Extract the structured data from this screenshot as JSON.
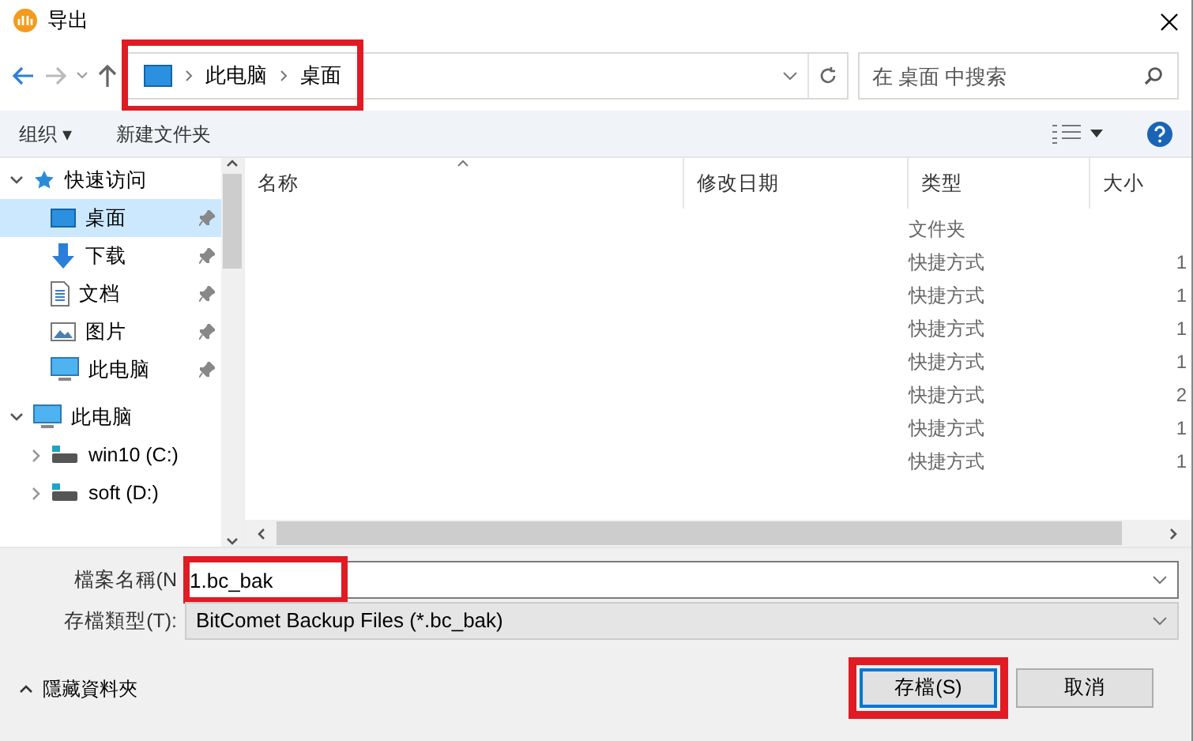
{
  "window": {
    "title": "导出"
  },
  "address": {
    "crumbs": [
      "此电脑",
      "桌面"
    ],
    "highlighted": true
  },
  "search": {
    "placeholder": "在 桌面 中搜索"
  },
  "toolbar": {
    "organize": "组织 ▾",
    "new_folder": "新建文件夹"
  },
  "sidebar": {
    "items": [
      {
        "label": "快速访问",
        "kind": "star",
        "expanded": true,
        "selected": false,
        "children": [
          {
            "label": "桌面",
            "kind": "desktop",
            "pinned": true,
            "selected": true
          },
          {
            "label": "下载",
            "kind": "download",
            "pinned": true,
            "selected": false
          },
          {
            "label": "文档",
            "kind": "document",
            "pinned": true,
            "selected": false
          },
          {
            "label": "图片",
            "kind": "picture",
            "pinned": true,
            "selected": false
          },
          {
            "label": "此电脑",
            "kind": "computer",
            "pinned": true,
            "selected": false
          }
        ]
      },
      {
        "label": "此电脑",
        "kind": "computer",
        "expanded": true,
        "selected": false,
        "children": [
          {
            "label": "win10 (C:)",
            "kind": "drive",
            "expanded": false,
            "selected": false
          },
          {
            "label": "soft (D:)",
            "kind": "drive",
            "expanded": false,
            "selected": false
          }
        ]
      }
    ]
  },
  "table": {
    "columns": [
      "名称",
      "修改日期",
      "类型",
      "大小"
    ],
    "rows": [
      {
        "type": "文件夹"
      },
      {
        "type": "快捷方式",
        "size": "1"
      },
      {
        "type": "快捷方式",
        "size": "1"
      },
      {
        "type": "快捷方式",
        "size": "1"
      },
      {
        "type": "快捷方式",
        "size": "1"
      },
      {
        "type": "快捷方式",
        "size": "2"
      },
      {
        "type": "快捷方式",
        "size": "1"
      },
      {
        "type": "快捷方式",
        "size": "1"
      }
    ]
  },
  "filename": {
    "label": "檔案名稱(N",
    "value": "1.bc_bak",
    "highlighted": true
  },
  "filetype": {
    "label": "存檔類型(T):",
    "value": "BitComet Backup Files (*.bc_bak)"
  },
  "hide_folders": "隱藏資料夾",
  "buttons": [
    {
      "label": "存檔(S)",
      "kind": "primary",
      "highlighted": true
    },
    {
      "label": "取消",
      "kind": "secondary",
      "highlighted": false
    }
  ]
}
